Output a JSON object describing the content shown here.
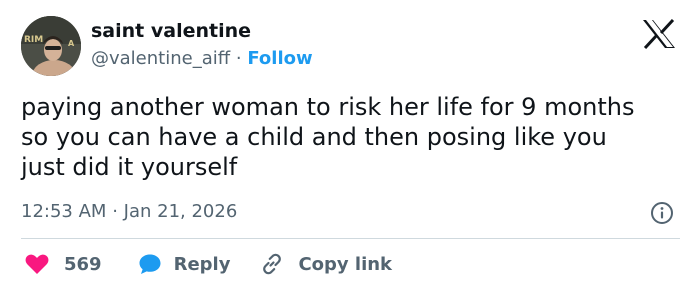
{
  "author": {
    "name": "saint valentine",
    "handle": "@valentine_aiff",
    "separator": "·",
    "follow_label": "Follow",
    "avatar_text": "RIM"
  },
  "tweet": {
    "lines": [
      "paying another woman to risk her life for 9 months",
      "so you can have a child and then posing like you",
      "just did it yourself"
    ],
    "time": "12:53 AM",
    "separator": "·",
    "date": "Jan 21, 2026"
  },
  "actions": {
    "like_count": "569",
    "reply_label": "Reply",
    "copy_link_label": "Copy link"
  },
  "colors": {
    "like": "#f91880",
    "reply": "#1d9bf0",
    "follow": "#1d9bf0",
    "secondary_text": "#536471"
  },
  "icons": {
    "brand": "x-logo-icon",
    "info": "info-icon",
    "like": "heart-icon",
    "reply": "speech-bubble-icon",
    "copy": "link-icon"
  }
}
